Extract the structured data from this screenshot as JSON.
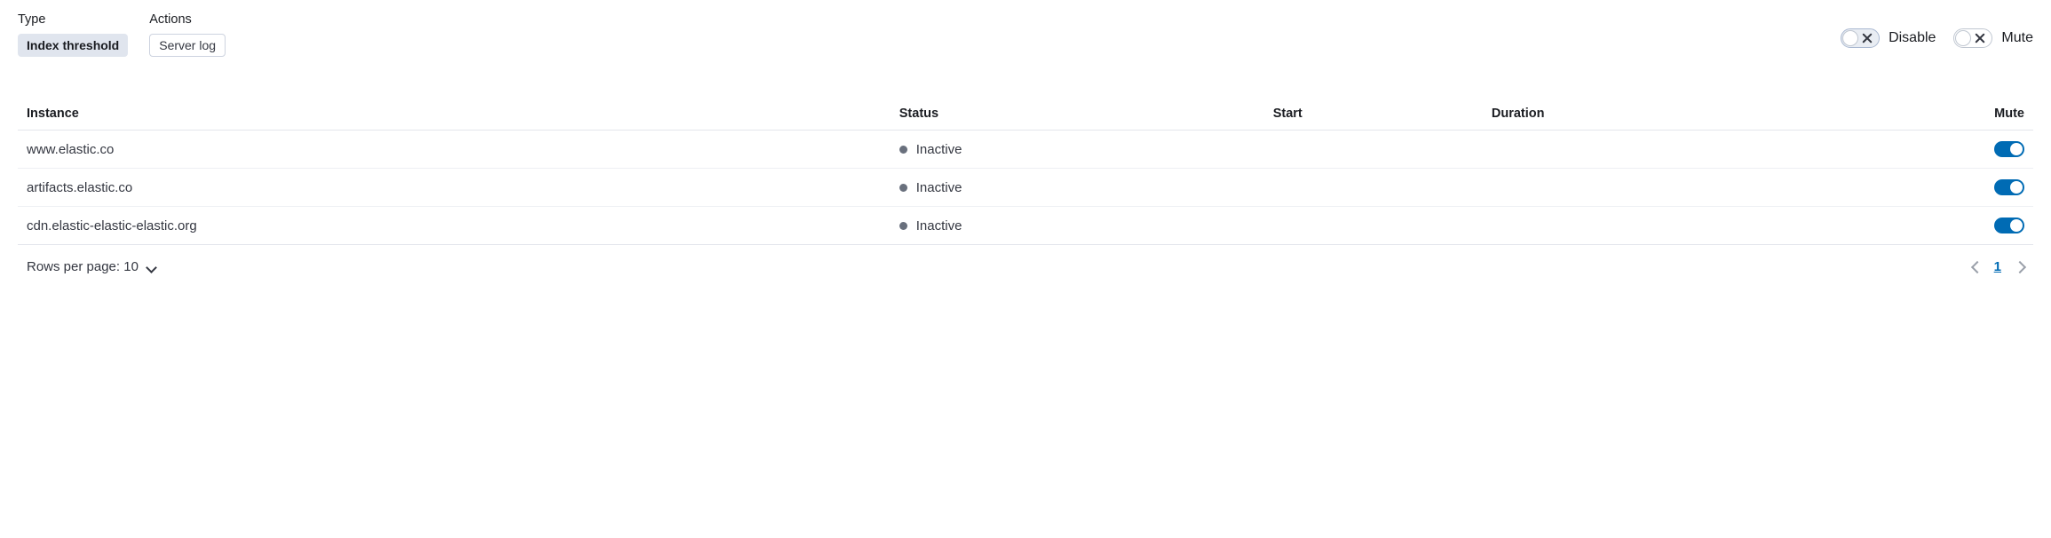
{
  "header": {
    "type_label": "Type",
    "type_badge": "Index threshold",
    "actions_label": "Actions",
    "actions_badge": "Server log",
    "disable_label": "Disable",
    "mute_label": "Mute"
  },
  "table": {
    "columns": {
      "instance": "Instance",
      "status": "Status",
      "start": "Start",
      "duration": "Duration",
      "mute": "Mute"
    },
    "rows": [
      {
        "instance": "www.elastic.co",
        "status": "Inactive",
        "start": "",
        "duration": "",
        "mute": true
      },
      {
        "instance": "artifacts.elastic.co",
        "status": "Inactive",
        "start": "",
        "duration": "",
        "mute": true
      },
      {
        "instance": "cdn.elastic-elastic-elastic.org",
        "status": "Inactive",
        "start": "",
        "duration": "",
        "mute": true
      }
    ]
  },
  "footer": {
    "rows_per_page_label": "Rows per page: 10",
    "current_page": "1"
  }
}
